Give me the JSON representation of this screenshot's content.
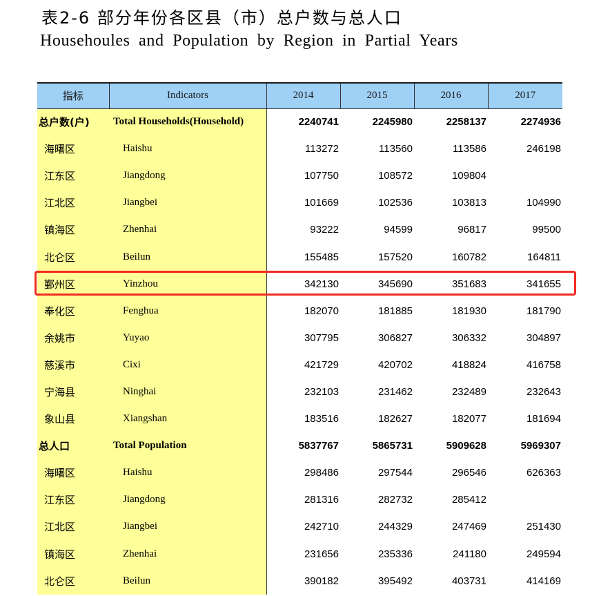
{
  "title_zh": "表2-6 部分年份各区县（市）总户数与总人口",
  "title_en": "Househoules and Population by Region in Partial Years",
  "columns": {
    "indicator_zh": "指标",
    "indicator_en": "Indicators",
    "years": [
      "2014",
      "2015",
      "2016",
      "2017"
    ]
  },
  "rows": [
    {
      "zh": "总户数(户)",
      "en": "Total Households(Household)",
      "total": true,
      "values": [
        "2240741",
        "2245980",
        "2258137",
        "2274936"
      ]
    },
    {
      "zh": "海曙区",
      "en": "Haishu",
      "values": [
        "113272",
        "113560",
        "113586",
        "246198"
      ]
    },
    {
      "zh": "江东区",
      "en": "Jiangdong",
      "values": [
        "107750",
        "108572",
        "109804",
        ""
      ]
    },
    {
      "zh": "江北区",
      "en": "Jiangbei",
      "values": [
        "101669",
        "102536",
        "103813",
        "104990"
      ]
    },
    {
      "zh": "镇海区",
      "en": "Zhenhai",
      "values": [
        "93222",
        "94599",
        "96817",
        "99500"
      ]
    },
    {
      "zh": "北仑区",
      "en": "Beilun",
      "values": [
        "155485",
        "157520",
        "160782",
        "164811"
      ]
    },
    {
      "zh": "鄞州区",
      "en": "Yinzhou",
      "highlighted": true,
      "values": [
        "342130",
        "345690",
        "351683",
        "341655"
      ]
    },
    {
      "zh": "奉化区",
      "en": "Fenghua",
      "values": [
        "182070",
        "181885",
        "181930",
        "181790"
      ]
    },
    {
      "zh": "余姚市",
      "en": "Yuyao",
      "values": [
        "307795",
        "306827",
        "306332",
        "304897"
      ]
    },
    {
      "zh": "慈溪市",
      "en": "Cixi",
      "values": [
        "421729",
        "420702",
        "418824",
        "416758"
      ]
    },
    {
      "zh": "宁海县",
      "en": "Ninghai",
      "values": [
        "232103",
        "231462",
        "232489",
        "232643"
      ]
    },
    {
      "zh": "象山县",
      "en": "Xiangshan",
      "values": [
        "183516",
        "182627",
        "182077",
        "181694"
      ]
    },
    {
      "zh": "总人口",
      "en": "Total Population",
      "total": true,
      "values": [
        "5837767",
        "5865731",
        "5909628",
        "5969307"
      ]
    },
    {
      "zh": "海曙区",
      "en": "Haishu",
      "values": [
        "298486",
        "297544",
        "296546",
        "626363"
      ]
    },
    {
      "zh": "江东区",
      "en": "Jiangdong",
      "values": [
        "281316",
        "282732",
        "285412",
        ""
      ]
    },
    {
      "zh": "江北区",
      "en": "Jiangbei",
      "values": [
        "242710",
        "244329",
        "247469",
        "251430"
      ]
    },
    {
      "zh": "镇海区",
      "en": "Zhenhai",
      "values": [
        "231656",
        "235336",
        "241180",
        "249594"
      ]
    },
    {
      "zh": "北仑区",
      "en": "Beilun",
      "values": [
        "390182",
        "395492",
        "403731",
        "414169"
      ]
    }
  ],
  "highlight_color": "#f02a22",
  "header_color": "#9fd0f5",
  "indicator_bg_color": "#ffff99"
}
